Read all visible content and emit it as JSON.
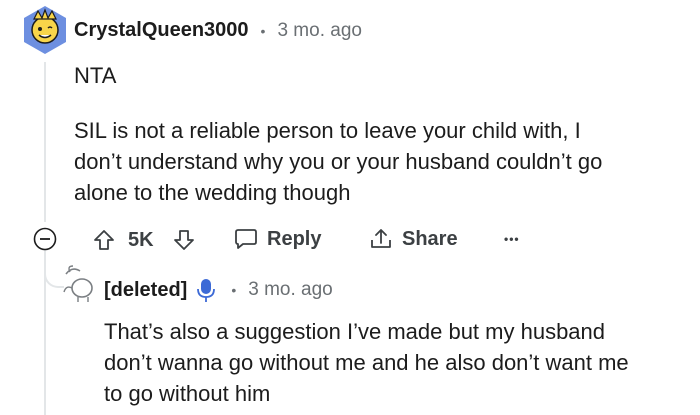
{
  "comment": {
    "username": "CrystalQueen3000",
    "time": "3 mo. ago",
    "separator": "•",
    "lines": [
      "NTA",
      "SIL is not a reliable person to leave your child with, I",
      "don’t understand why you or your husband couldn’t go",
      "alone to the wedding though"
    ],
    "vote_count": "5K",
    "reply_label": "Reply",
    "share_label": "Share",
    "more_label": "•••"
  },
  "reply": {
    "username": "[deleted]",
    "time": "3 mo. ago",
    "separator": "•",
    "lines": [
      "That’s also a suggestion I’ve made but my husband",
      "don’t wanna go without me and he also don’t want me",
      "to go without him"
    ]
  },
  "colors": {
    "avatar_bg": "#6d8fe0",
    "avatar_face": "#f8d54a",
    "mic": "#3c6ad6",
    "thread_line": "#e3e6e8"
  },
  "icons": {
    "collapse": "collapse-minus-icon",
    "upvote": "upvote-arrow-icon",
    "downvote": "downvote-arrow-icon",
    "reply": "speech-bubble-icon",
    "share": "share-icon",
    "mic": "microphone-icon"
  }
}
